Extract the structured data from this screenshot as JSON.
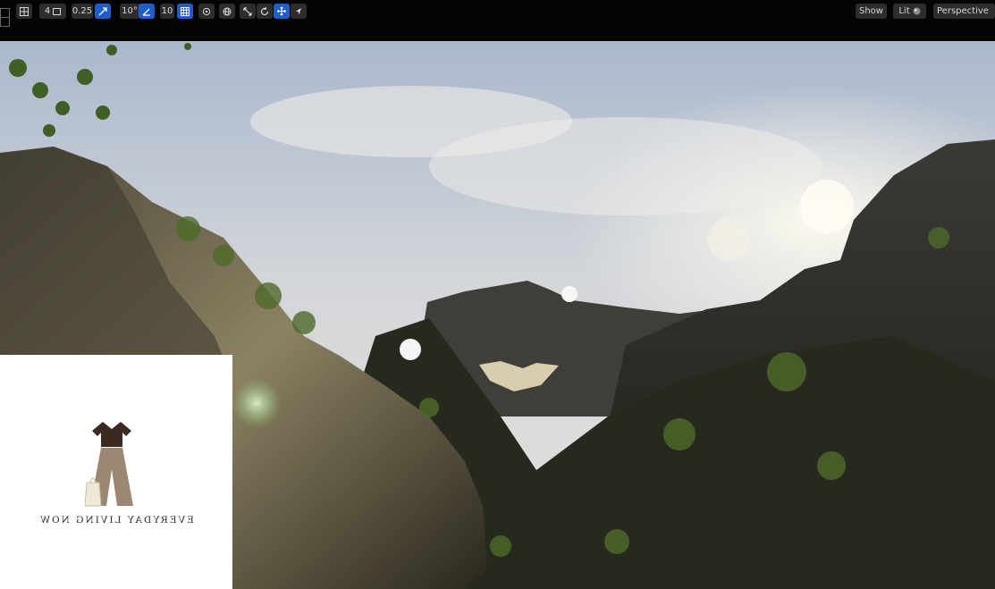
{
  "toolbar": {
    "snap_distance": "0.25",
    "rotation_snap": "10°",
    "grid_snap": "10",
    "camera_speed": "4",
    "view_mode": "Perspective",
    "lighting_mode": "Lit",
    "show_label": "Show"
  },
  "logo": {
    "text": "EVERYDAY LIVING NOW"
  },
  "colors": {
    "toolbar_bg": "#040404",
    "button_bg": "#2d2d2d",
    "active_blue": "#1f5ec9"
  }
}
